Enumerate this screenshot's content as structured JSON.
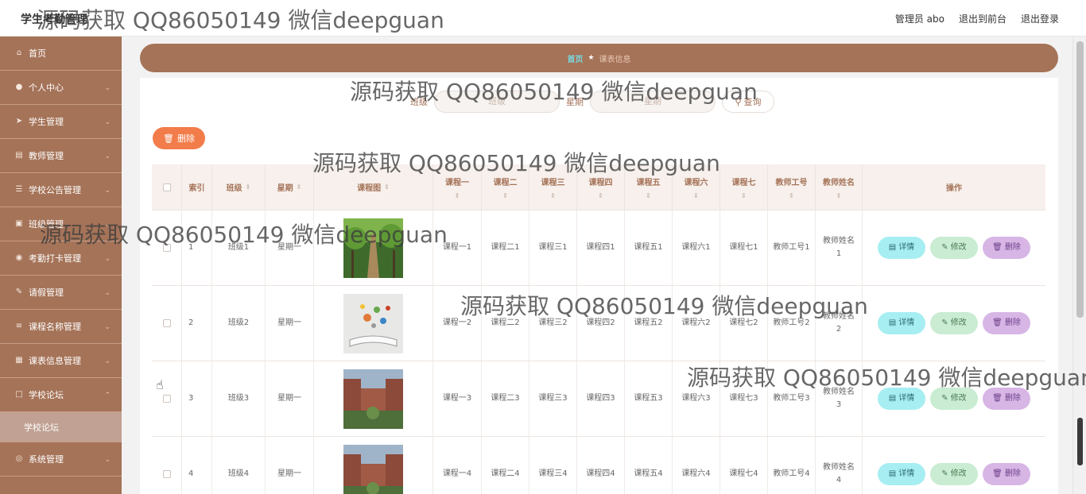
{
  "app": {
    "title": "学生考勤管理"
  },
  "top_links": {
    "admin": "管理员 abo",
    "front": "退出到前台",
    "logout": "退出登录"
  },
  "sidebar": {
    "items": [
      {
        "label": "首页",
        "icon": "home-icon"
      },
      {
        "label": "个人中心",
        "icon": "user-icon"
      },
      {
        "label": "学生管理",
        "icon": "send-icon"
      },
      {
        "label": "教师管理",
        "icon": "id-card-icon"
      },
      {
        "label": "学校公告管理",
        "icon": "sliders-icon"
      },
      {
        "label": "班级管理",
        "icon": "clipboard-icon"
      },
      {
        "label": "考勤打卡管理",
        "icon": "location-icon"
      },
      {
        "label": "请假管理",
        "icon": "pencil-icon"
      },
      {
        "label": "课程名称管理",
        "icon": "list-icon"
      },
      {
        "label": "课表信息管理",
        "icon": "table-icon"
      },
      {
        "label": "学校论坛",
        "icon": "forum-icon"
      }
    ],
    "sub_item": "学校论坛",
    "last_item": {
      "label": "系统管理",
      "icon": "globe-icon"
    }
  },
  "breadcrumb": {
    "home": "首页",
    "current": "课表信息"
  },
  "search": {
    "class_label": "班级",
    "class_placeholder": "班级",
    "week_label": "星期",
    "week_placeholder": "星期",
    "query_label": "查询"
  },
  "delete_label": "删除",
  "table": {
    "headers": [
      "索引",
      "班级",
      "星期",
      "课程图",
      "课程一",
      "课程二",
      "课程三",
      "课程四",
      "课程五",
      "课程六",
      "课程七",
      "教师工号",
      "教师姓名",
      "操作"
    ],
    "rows": [
      {
        "index": "1",
        "class": "班级1",
        "week": "星期一",
        "c1": "课程一1",
        "c2": "课程二1",
        "c3": "课程三1",
        "c4": "课程四1",
        "c5": "课程五1",
        "c6": "课程六1",
        "c7": "课程七1",
        "tid": "教师工号1",
        "tname": "教师姓名1"
      },
      {
        "index": "2",
        "class": "班级2",
        "week": "星期一",
        "c1": "课程一2",
        "c2": "课程二2",
        "c3": "课程三2",
        "c4": "课程四2",
        "c5": "课程五2",
        "c6": "课程六2",
        "c7": "课程七2",
        "tid": "教师工号2",
        "tname": "教师姓名2"
      },
      {
        "index": "3",
        "class": "班级3",
        "week": "星期一",
        "c1": "课程一3",
        "c2": "课程二3",
        "c3": "课程三3",
        "c4": "课程四3",
        "c5": "课程五3",
        "c6": "课程六3",
        "c7": "课程七3",
        "tid": "教师工号3",
        "tname": "教师姓名3"
      },
      {
        "index": "4",
        "class": "班级4",
        "week": "星期一",
        "c1": "课程一4",
        "c2": "课程二4",
        "c3": "课程三4",
        "c4": "课程四4",
        "c5": "课程五4",
        "c6": "课程六4",
        "c7": "课程七4",
        "tid": "教师工号4",
        "tname": "教师姓名4"
      }
    ],
    "actions": {
      "detail": "详情",
      "edit": "修改",
      "delete": "删除"
    }
  },
  "watermark": "源码获取 QQ86050149 微信deepguan",
  "colors": {
    "accent": "#a57358",
    "delete": "#f27c4a",
    "detail": "#a7eef2",
    "edit": "#c9ecd2",
    "remove": "#d7b6e6",
    "home_link": "#7ad6df"
  }
}
